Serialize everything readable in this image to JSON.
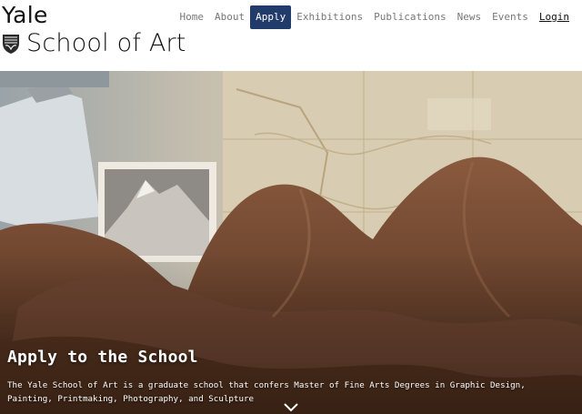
{
  "logo": {
    "line1": "Yale",
    "line2": "School of Art"
  },
  "nav": {
    "items": [
      {
        "label": "Home"
      },
      {
        "label": "About"
      },
      {
        "label": "Apply"
      },
      {
        "label": "Exhibitions"
      },
      {
        "label": "Publications"
      },
      {
        "label": "News"
      },
      {
        "label": "Events"
      },
      {
        "label": "Login"
      }
    ],
    "active": "Apply"
  },
  "hero": {
    "title": "Apply to the School",
    "description": "The Yale School of Art is a graduate school that confers Master of Fine Arts Degrees in Graphic Design, Painting, Printmaking, Photography, and Sculpture"
  },
  "icons": {
    "shield": "shield-icon",
    "scroll": "chevron-down-icon"
  },
  "colors": {
    "accent": "#213c6b",
    "nav_text": "#777777",
    "fabric": "#6b4430"
  }
}
